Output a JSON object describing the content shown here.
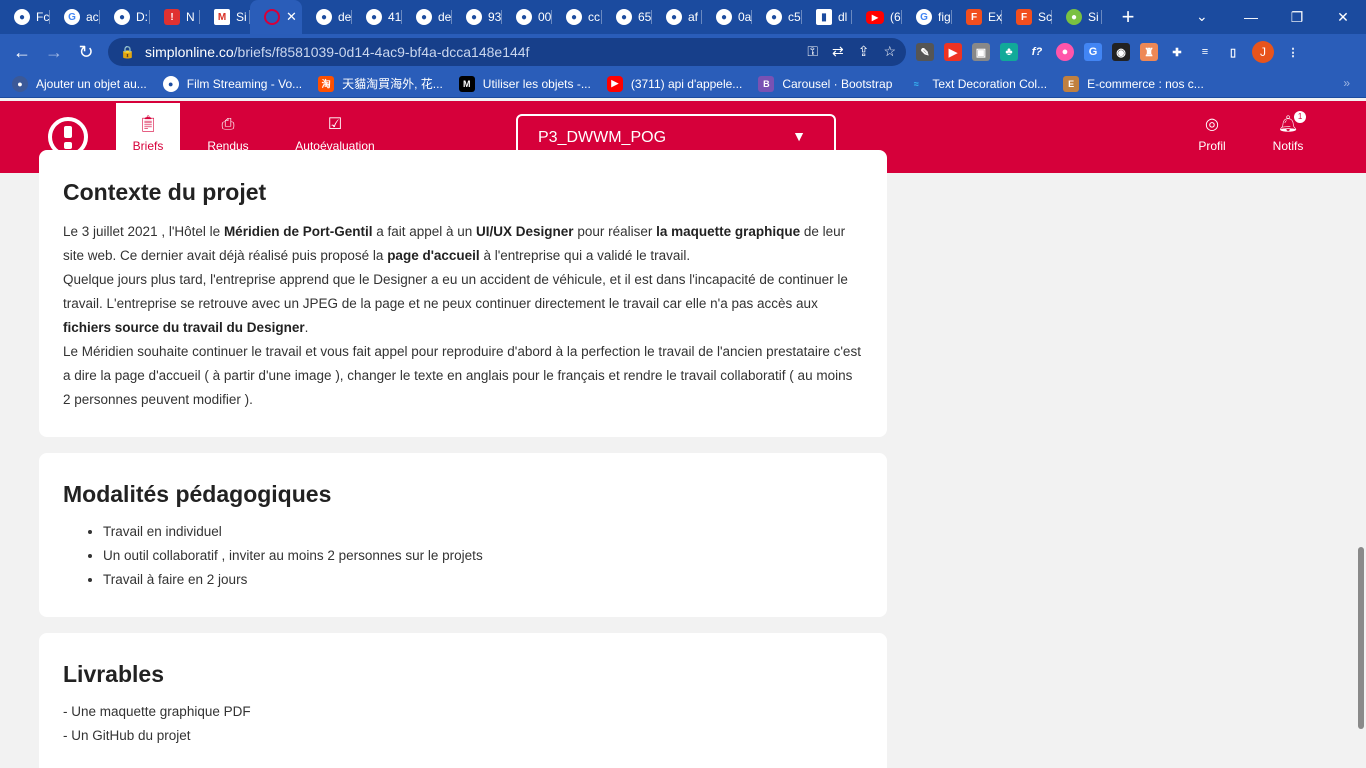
{
  "browser": {
    "tabs": [
      {
        "title": "Fc",
        "icon": "globe"
      },
      {
        "title": "ac",
        "icon": "google"
      },
      {
        "title": "D:",
        "icon": "globe"
      },
      {
        "title": "N",
        "icon": "red"
      },
      {
        "title": "Si",
        "icon": "gmail"
      },
      {
        "title": "",
        "icon": "simplon",
        "active": true
      },
      {
        "title": "de",
        "icon": "globe"
      },
      {
        "title": "41",
        "icon": "globe"
      },
      {
        "title": "de",
        "icon": "globe"
      },
      {
        "title": "93",
        "icon": "globe"
      },
      {
        "title": "00",
        "icon": "globe"
      },
      {
        "title": "cc",
        "icon": "globe"
      },
      {
        "title": "65",
        "icon": "globe"
      },
      {
        "title": "af",
        "icon": "globe"
      },
      {
        "title": "0a",
        "icon": "globe"
      },
      {
        "title": "c5",
        "icon": "globe"
      },
      {
        "title": "dl",
        "icon": "chart"
      },
      {
        "title": "(6",
        "icon": "yt"
      },
      {
        "title": "fig",
        "icon": "google"
      },
      {
        "title": "Ex",
        "icon": "figma"
      },
      {
        "title": "Sc",
        "icon": "figma"
      },
      {
        "title": "Si",
        "icon": "green"
      }
    ],
    "url_domain": "simplonline.co",
    "url_path": "/briefs/f8581039-0d14-4ac9-bf4a-dcca148e144f",
    "profile_initial": "J",
    "bookmarks": [
      {
        "label": "Ajouter un objet au...",
        "icon_color": "#3b5998"
      },
      {
        "label": "Film Streaming - Vo...",
        "icon_color": "#ffffff"
      },
      {
        "label": "天貓淘買海外, 花...",
        "icon_color": "#ff5000"
      },
      {
        "label": "Utiliser les objets -...",
        "icon_color": "#000000"
      },
      {
        "label": "(3711) api d'appele...",
        "icon_color": "#ff0000"
      },
      {
        "label": "Carousel · Bootstrap",
        "icon_color": "#7952b3"
      },
      {
        "label": "Text Decoration Col...",
        "icon_color": "#38bdf8"
      },
      {
        "label": "E-commerce : nos c...",
        "icon_color": "#c08040"
      }
    ]
  },
  "header": {
    "nav": {
      "briefs": "Briefs",
      "rendus": "Rendus",
      "autoevaluation": "Autoévaluation",
      "profil": "Profil",
      "notifs": "Notifs"
    },
    "promo": "P3_DWWM_POG",
    "notif_count": "1",
    "brand_color": "#d6003a"
  },
  "contexte": {
    "title": "Contexte du projet"
  },
  "modalites": {
    "title": "Modalités pédagogiques",
    "items": [
      "Travail en individuel",
      "Un outil collaboratif , inviter au moins 2 personnes sur le projets",
      "Travail à faire en 2 jours"
    ]
  },
  "livrables": {
    "title": "Livrables",
    "items": [
      "- Une maquette graphique PDF",
      "- Un GitHub du projet"
    ]
  }
}
